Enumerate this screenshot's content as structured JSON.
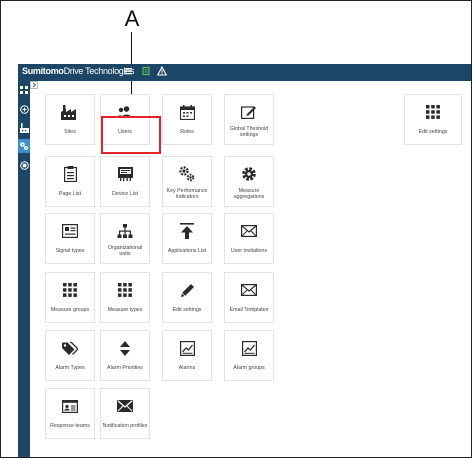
{
  "callout": {
    "letter": "A"
  },
  "header": {
    "brand_bold": "Sumitomo",
    "brand_rest": "Drive Technologies",
    "icons": [
      "menu-icon",
      "leaf-icon",
      "warning-icon"
    ]
  },
  "sidebar": {
    "icons": [
      "grid-icon",
      "plus-circle-icon",
      "factory-icon",
      "gears-icon",
      "box-icon"
    ]
  },
  "tiles": [
    {
      "id": "sites",
      "label": "Sites",
      "icon": "factory-icon"
    },
    {
      "id": "users",
      "label": "Users",
      "icon": "users-icon"
    },
    {
      "id": "roles",
      "label": "Roles",
      "icon": "roles-icon"
    },
    {
      "id": "global-threshold",
      "label": "Global Theshold settings",
      "icon": "edit-box-icon"
    },
    {
      "id": "edit-settings-top",
      "label": "Edit settings",
      "icon": "grid-icon"
    },
    {
      "id": "page-list",
      "label": "Page List",
      "icon": "page-list-icon"
    },
    {
      "id": "device-list",
      "label": "Device List",
      "icon": "device-icon"
    },
    {
      "id": "kpi",
      "label": "Key Performance Indicators",
      "icon": "cogs-icon"
    },
    {
      "id": "measure-aggregations",
      "label": "Measure aggregations",
      "icon": "gear-icon"
    },
    {
      "id": "signal-types",
      "label": "Signal types",
      "icon": "signal-icon"
    },
    {
      "id": "org-units",
      "label": "Organizational units",
      "icon": "org-chart-icon"
    },
    {
      "id": "applications-list",
      "label": "Applications List",
      "icon": "upload-icon"
    },
    {
      "id": "user-invitations",
      "label": "User invitations",
      "icon": "envelope-icon"
    },
    {
      "id": "measure-groups",
      "label": "Measure groups",
      "icon": "grid-icon"
    },
    {
      "id": "measure-types",
      "label": "Measure types",
      "icon": "grid-icon"
    },
    {
      "id": "edit-settings",
      "label": "Edit settings",
      "icon": "pencil-icon"
    },
    {
      "id": "email-templates",
      "label": "Email Templates",
      "icon": "envelope-icon"
    },
    {
      "id": "alarm-types",
      "label": "Alarm Types",
      "icon": "tag-icon"
    },
    {
      "id": "alarm-priorities",
      "label": "Alarm Priorities",
      "icon": "sort-icon"
    },
    {
      "id": "alarms",
      "label": "Alarms",
      "icon": "chart-box-icon"
    },
    {
      "id": "alarm-groups",
      "label": "Alarm groups",
      "icon": "chart-box-icon"
    },
    {
      "id": "response-teams",
      "label": "Response teams",
      "icon": "id-card-icon"
    },
    {
      "id": "notification-profiles",
      "label": "Notification profiles",
      "icon": "envelope-filled-icon"
    }
  ]
}
